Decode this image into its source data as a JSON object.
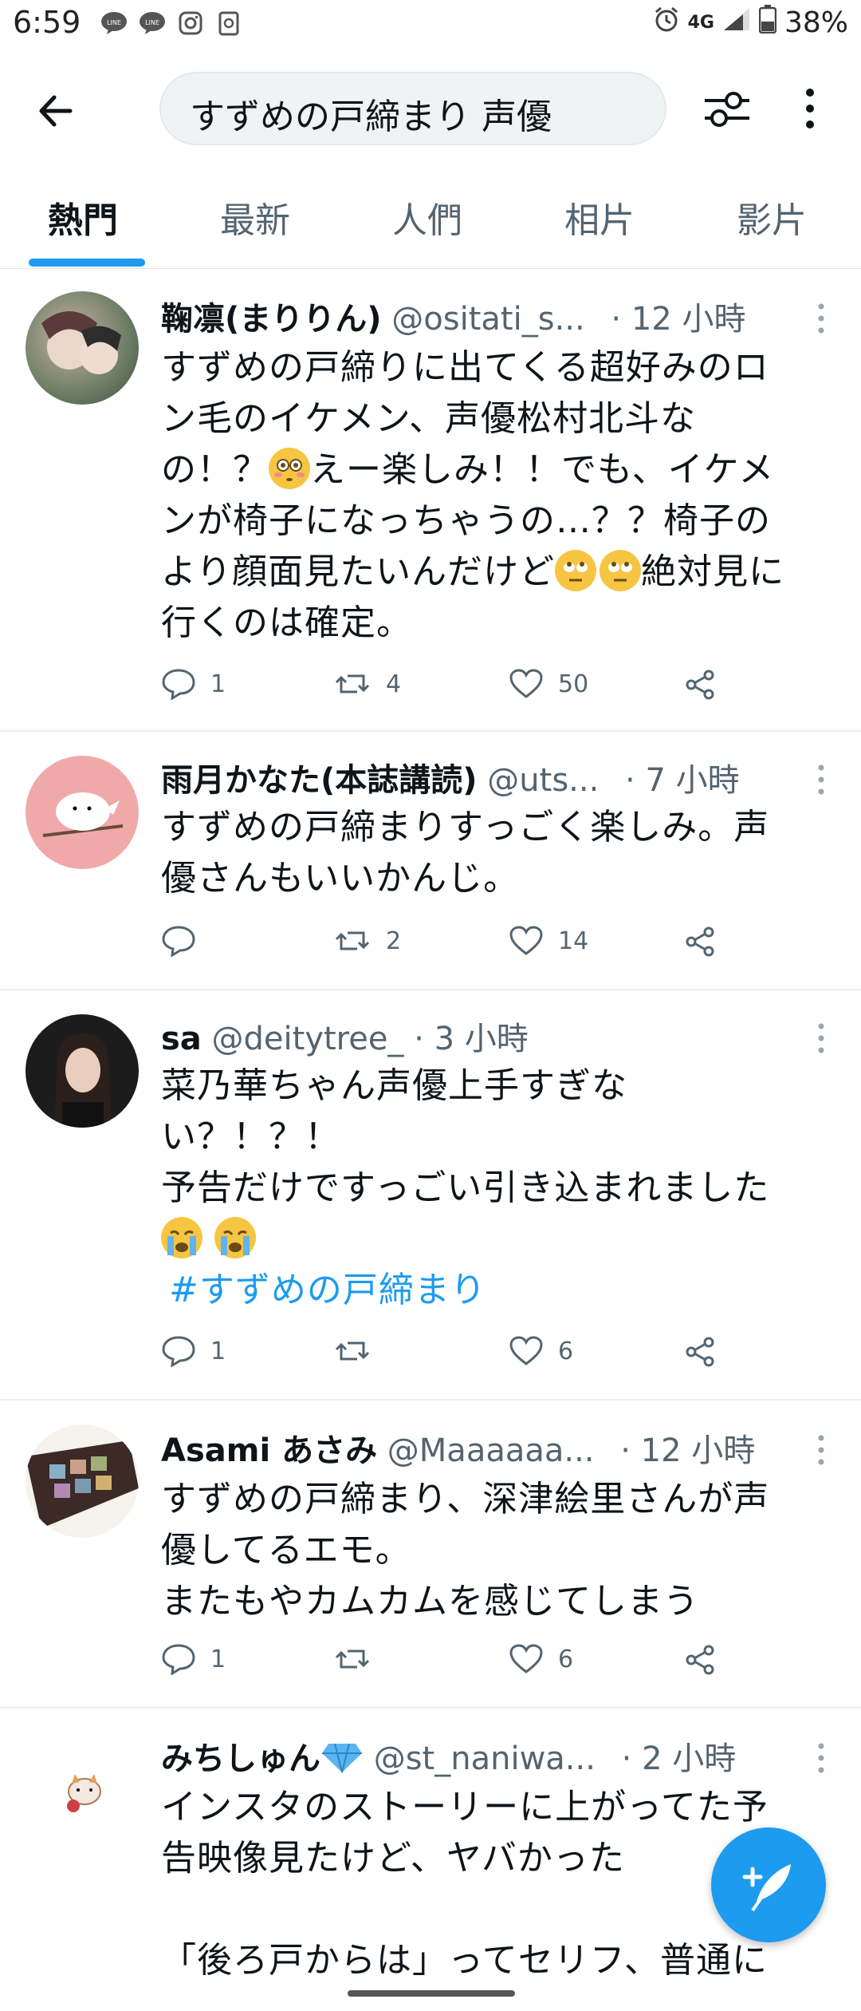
{
  "status": {
    "time": "6:59",
    "network": "4G",
    "battery": "38%",
    "left_icons": [
      "line-icon",
      "line-icon",
      "instagram-icon",
      "clipboard-icon"
    ]
  },
  "header": {
    "query": "すずめの戸締まり 声優"
  },
  "tabs": [
    {
      "label": "熱門",
      "active": true
    },
    {
      "label": "最新",
      "active": false
    },
    {
      "label": "人們",
      "active": false
    },
    {
      "label": "相片",
      "active": false
    },
    {
      "label": "影片",
      "active": false
    }
  ],
  "tweets": [
    {
      "name": "鞠凛(まりりん)",
      "handle": "@ositati_s...",
      "time": "· 12 小時",
      "lines": [
        "すずめの戸締りに出てくる超好みのロ",
        "ン毛のイケメン、声優松村北斗な",
        "の！？",
        "えー楽しみ！！でも、イケメ",
        "ンが椅子になっちゃうの…？？椅子の",
        "より顔面見たいんだけど",
        "絶対見に",
        "行くのは確定。"
      ],
      "replies": "1",
      "retweets": "4",
      "likes": "50"
    },
    {
      "name": "雨月かなた(本誌講読)",
      "handle": "@uts...",
      "time": "· 7 小時",
      "lines": [
        "すずめの戸締まりすっごく楽しみ。声",
        "優さんもいいかんじ。"
      ],
      "replies": "",
      "retweets": "2",
      "likes": "14"
    },
    {
      "name": "sa",
      "handle": "@deitytree_",
      "time": "· 3 小時",
      "lines": [
        "菜乃華ちゃん声優上手すぎな",
        "い？！？！",
        "予告だけですっごい引き込まれました"
      ],
      "hashtag": "#すずめの戸締まり",
      "replies": "1",
      "retweets": "",
      "likes": "6"
    },
    {
      "name": "Asami あさみ",
      "handle": "@Maaaaaa...",
      "time": "· 12 小時",
      "lines": [
        "すずめの戸締まり、深津絵里さんが声",
        "優してるエモ。",
        "またもやカムカムを感じてしまう"
      ],
      "replies": "1",
      "retweets": "",
      "likes": "6"
    },
    {
      "name": "みちしゅん",
      "handle": "@st_naniwa...",
      "time": "· 2 小時",
      "lines": [
        "インスタのストーリーに上がってた予",
        "告映像見たけど、ヤバかった",
        "",
        "「後ろ戸からは」ってセリフ、普通に"
      ]
    }
  ],
  "colors": {
    "accent": "#1d9bf0",
    "text": "#0f1419",
    "secondary": "#536471"
  }
}
